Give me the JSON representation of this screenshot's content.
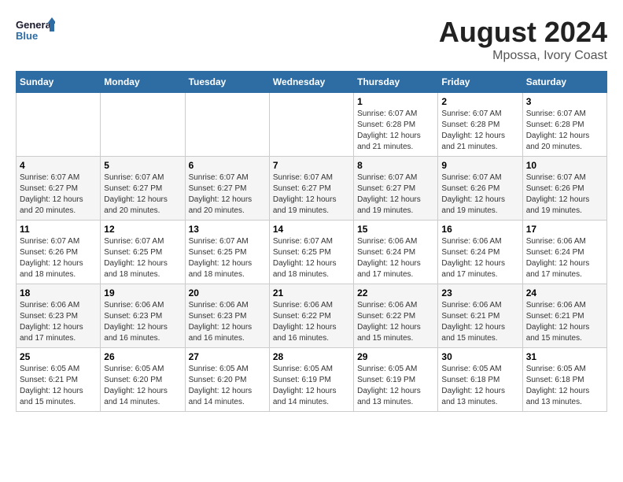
{
  "logo": {
    "line1": "General",
    "line2": "Blue"
  },
  "title": "August 2024",
  "subtitle": "Mpossa, Ivory Coast",
  "days_of_week": [
    "Sunday",
    "Monday",
    "Tuesday",
    "Wednesday",
    "Thursday",
    "Friday",
    "Saturday"
  ],
  "weeks": [
    [
      {
        "day": "",
        "info": ""
      },
      {
        "day": "",
        "info": ""
      },
      {
        "day": "",
        "info": ""
      },
      {
        "day": "",
        "info": ""
      },
      {
        "day": "1",
        "info": "Sunrise: 6:07 AM\nSunset: 6:28 PM\nDaylight: 12 hours\nand 21 minutes."
      },
      {
        "day": "2",
        "info": "Sunrise: 6:07 AM\nSunset: 6:28 PM\nDaylight: 12 hours\nand 21 minutes."
      },
      {
        "day": "3",
        "info": "Sunrise: 6:07 AM\nSunset: 6:28 PM\nDaylight: 12 hours\nand 20 minutes."
      }
    ],
    [
      {
        "day": "4",
        "info": "Sunrise: 6:07 AM\nSunset: 6:27 PM\nDaylight: 12 hours\nand 20 minutes."
      },
      {
        "day": "5",
        "info": "Sunrise: 6:07 AM\nSunset: 6:27 PM\nDaylight: 12 hours\nand 20 minutes."
      },
      {
        "day": "6",
        "info": "Sunrise: 6:07 AM\nSunset: 6:27 PM\nDaylight: 12 hours\nand 20 minutes."
      },
      {
        "day": "7",
        "info": "Sunrise: 6:07 AM\nSunset: 6:27 PM\nDaylight: 12 hours\nand 19 minutes."
      },
      {
        "day": "8",
        "info": "Sunrise: 6:07 AM\nSunset: 6:27 PM\nDaylight: 12 hours\nand 19 minutes."
      },
      {
        "day": "9",
        "info": "Sunrise: 6:07 AM\nSunset: 6:26 PM\nDaylight: 12 hours\nand 19 minutes."
      },
      {
        "day": "10",
        "info": "Sunrise: 6:07 AM\nSunset: 6:26 PM\nDaylight: 12 hours\nand 19 minutes."
      }
    ],
    [
      {
        "day": "11",
        "info": "Sunrise: 6:07 AM\nSunset: 6:26 PM\nDaylight: 12 hours\nand 18 minutes."
      },
      {
        "day": "12",
        "info": "Sunrise: 6:07 AM\nSunset: 6:25 PM\nDaylight: 12 hours\nand 18 minutes."
      },
      {
        "day": "13",
        "info": "Sunrise: 6:07 AM\nSunset: 6:25 PM\nDaylight: 12 hours\nand 18 minutes."
      },
      {
        "day": "14",
        "info": "Sunrise: 6:07 AM\nSunset: 6:25 PM\nDaylight: 12 hours\nand 18 minutes."
      },
      {
        "day": "15",
        "info": "Sunrise: 6:06 AM\nSunset: 6:24 PM\nDaylight: 12 hours\nand 17 minutes."
      },
      {
        "day": "16",
        "info": "Sunrise: 6:06 AM\nSunset: 6:24 PM\nDaylight: 12 hours\nand 17 minutes."
      },
      {
        "day": "17",
        "info": "Sunrise: 6:06 AM\nSunset: 6:24 PM\nDaylight: 12 hours\nand 17 minutes."
      }
    ],
    [
      {
        "day": "18",
        "info": "Sunrise: 6:06 AM\nSunset: 6:23 PM\nDaylight: 12 hours\nand 17 minutes."
      },
      {
        "day": "19",
        "info": "Sunrise: 6:06 AM\nSunset: 6:23 PM\nDaylight: 12 hours\nand 16 minutes."
      },
      {
        "day": "20",
        "info": "Sunrise: 6:06 AM\nSunset: 6:23 PM\nDaylight: 12 hours\nand 16 minutes."
      },
      {
        "day": "21",
        "info": "Sunrise: 6:06 AM\nSunset: 6:22 PM\nDaylight: 12 hours\nand 16 minutes."
      },
      {
        "day": "22",
        "info": "Sunrise: 6:06 AM\nSunset: 6:22 PM\nDaylight: 12 hours\nand 15 minutes."
      },
      {
        "day": "23",
        "info": "Sunrise: 6:06 AM\nSunset: 6:21 PM\nDaylight: 12 hours\nand 15 minutes."
      },
      {
        "day": "24",
        "info": "Sunrise: 6:06 AM\nSunset: 6:21 PM\nDaylight: 12 hours\nand 15 minutes."
      }
    ],
    [
      {
        "day": "25",
        "info": "Sunrise: 6:05 AM\nSunset: 6:21 PM\nDaylight: 12 hours\nand 15 minutes."
      },
      {
        "day": "26",
        "info": "Sunrise: 6:05 AM\nSunset: 6:20 PM\nDaylight: 12 hours\nand 14 minutes."
      },
      {
        "day": "27",
        "info": "Sunrise: 6:05 AM\nSunset: 6:20 PM\nDaylight: 12 hours\nand 14 minutes."
      },
      {
        "day": "28",
        "info": "Sunrise: 6:05 AM\nSunset: 6:19 PM\nDaylight: 12 hours\nand 14 minutes."
      },
      {
        "day": "29",
        "info": "Sunrise: 6:05 AM\nSunset: 6:19 PM\nDaylight: 12 hours\nand 13 minutes."
      },
      {
        "day": "30",
        "info": "Sunrise: 6:05 AM\nSunset: 6:18 PM\nDaylight: 12 hours\nand 13 minutes."
      },
      {
        "day": "31",
        "info": "Sunrise: 6:05 AM\nSunset: 6:18 PM\nDaylight: 12 hours\nand 13 minutes."
      }
    ]
  ]
}
